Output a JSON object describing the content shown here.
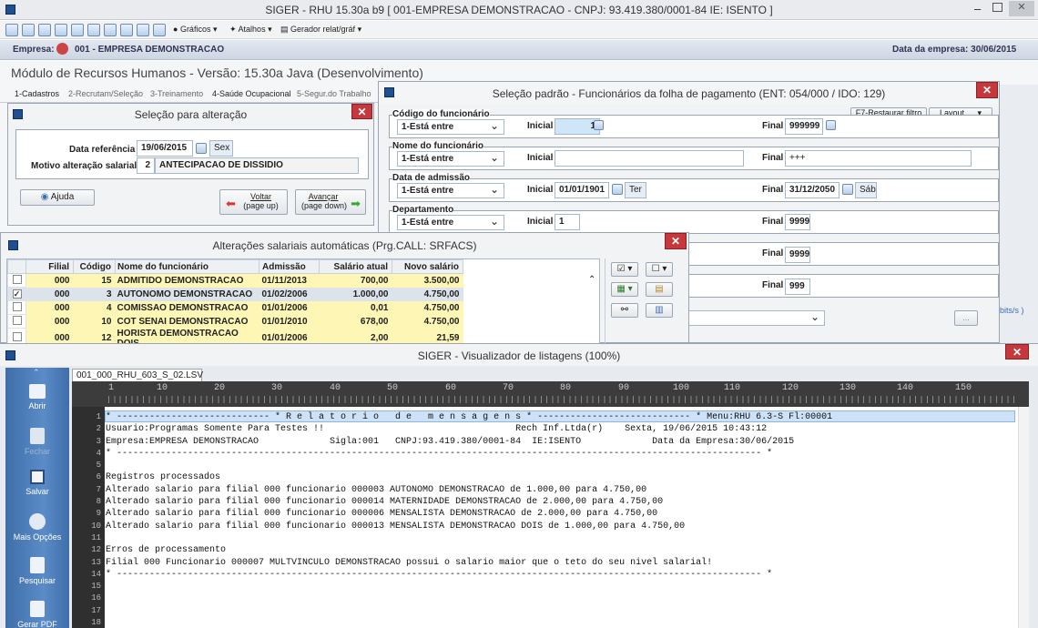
{
  "title_bar": "SIGER - RHU 15.30a b9 [ 001-EMPRESA DEMONSTRACAO - CNPJ: 93.419.380/0001-84 IE: ISENTO ]",
  "toolbar": {
    "graficos": "Gráficos",
    "atalhos": "Atalhos",
    "gerador": "Gerador relat/gráf"
  },
  "empresa_bar": {
    "label": "Empresa:",
    "value": "001 - EMPRESA DEMONSTRACAO",
    "date_label": "Data da empresa: 30/06/2015"
  },
  "module_title": "Módulo de Recursos Humanos - Versão: 15.30a Java (Desenvolvimento)",
  "module_tabs": [
    "1-Cadastros",
    "2-Recrutam/Seleção",
    "3-Treinamento",
    "4-Saúde Ocupacional",
    "5-Segur.do Trabalho"
  ],
  "sel_alt": {
    "title": "Seleção para alteração",
    "data_ref_label": "Data referência",
    "data_ref": "19/06/2015",
    "data_ref_day": "Sex",
    "motivo_label": "Motivo alteração salarial",
    "motivo_code": "2",
    "motivo_desc": "ANTECIPACAO DE DISSIDIO",
    "ajuda": "Ajuda",
    "voltar": "Voltar",
    "voltar_key": "(page up)",
    "avancar": "Avançar",
    "avancar_key": "(page down)"
  },
  "sel_padrao": {
    "title": "Seleção padrão - Funcionários da folha de pagamento (ENT: 054/000 / IDO: 129)",
    "restaurar": "F7-Restaurar filtro",
    "layout": "Layout",
    "inicial": "Inicial",
    "final": "Final",
    "groups": [
      {
        "title": "Código do funcionário",
        "op": "1-Está entre",
        "ini": "1",
        "fin": "999999"
      },
      {
        "title": "Nome do funcionário",
        "op": "1-Está entre",
        "ini": "",
        "fin": "+++"
      },
      {
        "title": "Data de admissão",
        "op": "1-Está entre",
        "ini": "01/01/1901",
        "ini_day": "Ter",
        "fin": "31/12/2050",
        "fin_day": "Sáb"
      },
      {
        "title": "Departamento",
        "op": "1-Está entre",
        "ini": "1",
        "fin": "9999"
      }
    ],
    "final_extra1": "9999",
    "final_extra2": "999",
    "partial_right": "bits/s )"
  },
  "alteracoes": {
    "title": "Alterações salariais automáticas (Prg.CALL: SRFACS)",
    "headers": [
      "Filial",
      "Código",
      "Nome do funcionário",
      "Admissão",
      "Salário atual",
      "Novo salário"
    ],
    "rows": [
      [
        "000",
        "15",
        "ADMITIDO DEMONSTRACAO",
        "01/11/2013",
        "700,00",
        "3.500,00"
      ],
      [
        "000",
        "3",
        "AUTONOMO DEMONSTRACAO",
        "01/02/2006",
        "1.000,00",
        "4.750,00"
      ],
      [
        "000",
        "4",
        "COMISSAO DEMONSTRACAO",
        "01/01/2006",
        "0,01",
        "4.750,00"
      ],
      [
        "000",
        "10",
        "COT SENAI DEMONSTRACAO",
        "01/01/2010",
        "678,00",
        "4.750,00"
      ],
      [
        "000",
        "12",
        "HORISTA DEMONSTRACAO DOIS",
        "01/01/2006",
        "2,00",
        "21,59"
      ]
    ]
  },
  "visualizador": {
    "title": "SIGER - Visualizador de listagens (100%)",
    "tab": "001_000_RHU_603_S_02.LSV",
    "sidebar": [
      "Abrir",
      "Fechar",
      "Salvar",
      "Mais Opções",
      "Pesquisar",
      "Gerar PDF"
    ],
    "ruler": [
      "1",
      "10",
      "20",
      "30",
      "40",
      "50",
      "60",
      "70",
      "80",
      "90",
      "100",
      "110",
      "120",
      "130",
      "140",
      "150"
    ],
    "lines": [
      "* ---------------------------- * R e l a t o r i o   d e   m e n s a g e n s * ---------------------------- * Menu:RHU 6.3-S Fl:00001",
      "Usuario:Programas Somente Para Testes !!                                   Rech Inf.Ltda(r)    Sexta, 19/06/2015 10:43:12",
      "Empresa:EMPRESA DEMONSTRACAO             Sigla:001   CNPJ:93.419.380/0001-84  IE:ISENTO             Data da Empresa:30/06/2015",
      "* ---------------------------------------------------------------------------------------------------------------------- *",
      "",
      "Registros processados",
      "Alterado salario para filial 000 funcionario 000003 AUTONOMO DEMONSTRACAO de 1.000,00 para 4.750,00",
      "Alterado salario para filial 000 funcionario 000014 MATERNIDADE DEMONSTRACAO de 2.000,00 para 4.750,00",
      "Alterado salario para filial 000 funcionario 000006 MENSALISTA DEMONSTRACAO de 2.000,00 para 4.750,00",
      "Alterado salario para filial 000 funcionario 000013 MENSALISTA DEMONSTRACAO DOIS de 1.000,00 para 4.750,00",
      "",
      "Erros de processamento",
      "Filial 000 Funcionario 000007 MULTVINCULO DEMONSTRACAO possui o salario maior que o teto do seu nivel salarial!",
      "* ---------------------------------------------------------------------------------------------------------------------- *",
      "",
      "",
      "",
      ""
    ]
  }
}
